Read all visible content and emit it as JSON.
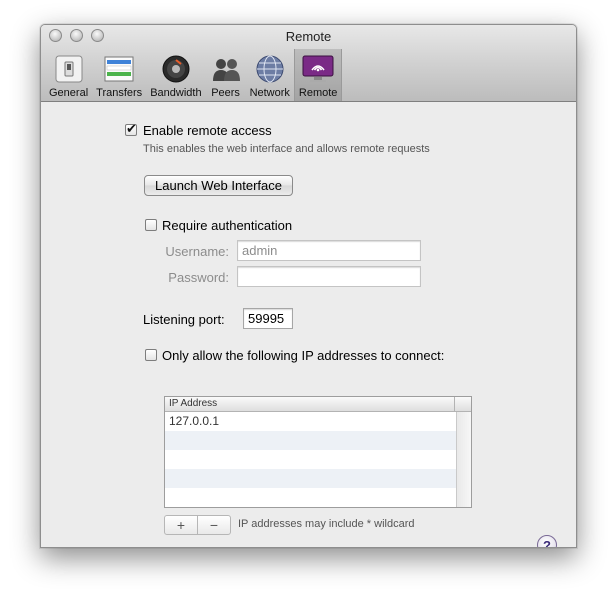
{
  "window": {
    "title": "Remote"
  },
  "toolbar": {
    "items": [
      {
        "label": "General",
        "icon": "switch-icon"
      },
      {
        "label": "Transfers",
        "icon": "transfers-icon"
      },
      {
        "label": "Bandwidth",
        "icon": "speaker-icon"
      },
      {
        "label": "Peers",
        "icon": "people-icon"
      },
      {
        "label": "Network",
        "icon": "globe-icon"
      },
      {
        "label": "Remote",
        "icon": "remote-screen-icon",
        "selected": true
      }
    ]
  },
  "remote": {
    "enable_label": "Enable remote access",
    "enable_checked": true,
    "enable_description": "This enables the web interface and allows remote requests",
    "launch_button": "Launch Web Interface",
    "require_auth_label": "Require authentication",
    "require_auth_checked": false,
    "username_label": "Username:",
    "username_value": "admin",
    "password_label": "Password:",
    "password_value": "",
    "port_label": "Listening port:",
    "port_value": "59995",
    "ip_only_label": "Only allow the following IP addresses to connect:",
    "ip_only_checked": false,
    "ip_table": {
      "header": "IP Address",
      "rows": [
        "127.0.0.1",
        "",
        "",
        "",
        ""
      ]
    },
    "add_label": "+",
    "remove_label": "−",
    "wildcard_hint": "IP addresses may include * wildcard",
    "help_label": "?"
  }
}
